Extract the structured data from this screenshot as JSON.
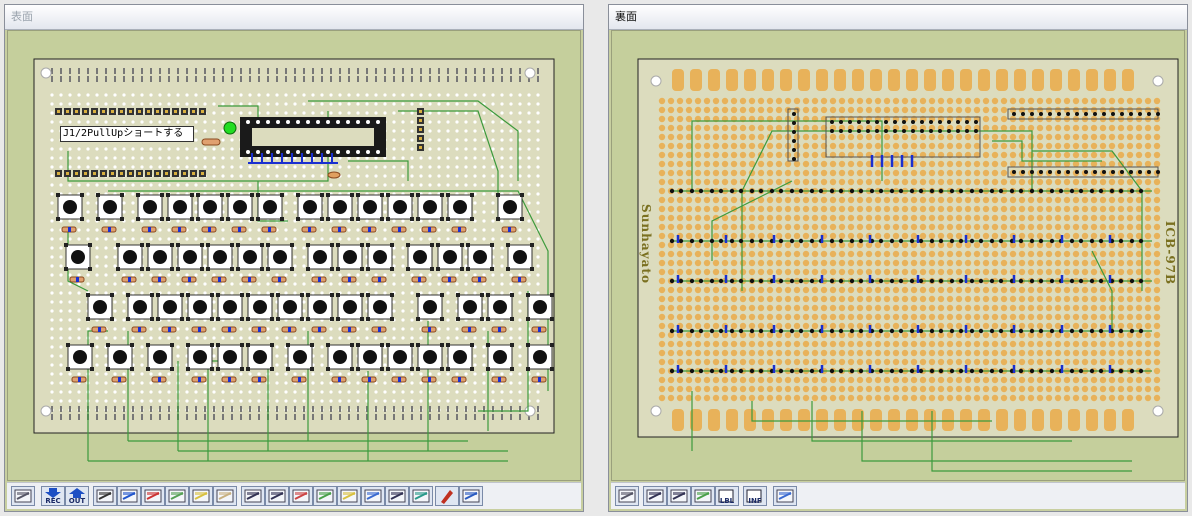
{
  "windows": {
    "front": {
      "title": "表面",
      "note_label": "J1/2PullUpショートする",
      "colors": {
        "board": "#dcdcbe",
        "trace": "#3c9a3c",
        "led": "#22dd22",
        "wire_blue": "#1a2fd0"
      },
      "toolbar": [
        {
          "icon": "print-icon",
          "label": ""
        },
        {
          "icon": "rec-icon",
          "label": "REC"
        },
        {
          "icon": "out-icon",
          "label": "OUT"
        },
        {
          "icon": "select-tool-icon",
          "label": ""
        },
        {
          "icon": "wire-blue-icon",
          "label": ""
        },
        {
          "icon": "wire-red-icon",
          "label": ""
        },
        {
          "icon": "layer-green-icon",
          "label": ""
        },
        {
          "icon": "layer-yellow-icon",
          "label": ""
        },
        {
          "icon": "layer-tan-icon",
          "label": ""
        },
        {
          "icon": "view-split-icon",
          "label": ""
        },
        {
          "icon": "view-front-icon",
          "label": ""
        },
        {
          "icon": "view-red-icon",
          "label": ""
        },
        {
          "icon": "view-green-icon",
          "label": ""
        },
        {
          "icon": "view-yellow-icon",
          "label": ""
        },
        {
          "icon": "view-blue-icon",
          "label": ""
        },
        {
          "icon": "view-plain-icon",
          "label": ""
        },
        {
          "icon": "view-teal-icon",
          "label": ""
        },
        {
          "icon": "pen-icon",
          "label": ""
        },
        {
          "icon": "settings-icon",
          "label": ""
        }
      ]
    },
    "back": {
      "title": "裏面",
      "brand_left": "Sunhayato",
      "brand_right": "ICB-97B",
      "colors": {
        "board": "#dcdcbe",
        "pad": "#e8b25a",
        "trace": "#3c9a3c",
        "wire_blue": "#1a2fd0"
      },
      "toolbar": [
        {
          "icon": "print-icon",
          "label": ""
        },
        {
          "icon": "view-front-icon",
          "label": ""
        },
        {
          "icon": "view-split-icon",
          "label": ""
        },
        {
          "icon": "view-green-icon",
          "label": ""
        },
        {
          "icon": "label-icon",
          "label": "LBL"
        },
        {
          "icon": "info-icon",
          "label": "INF"
        },
        {
          "icon": "view-blue-icon",
          "label": ""
        }
      ]
    }
  }
}
